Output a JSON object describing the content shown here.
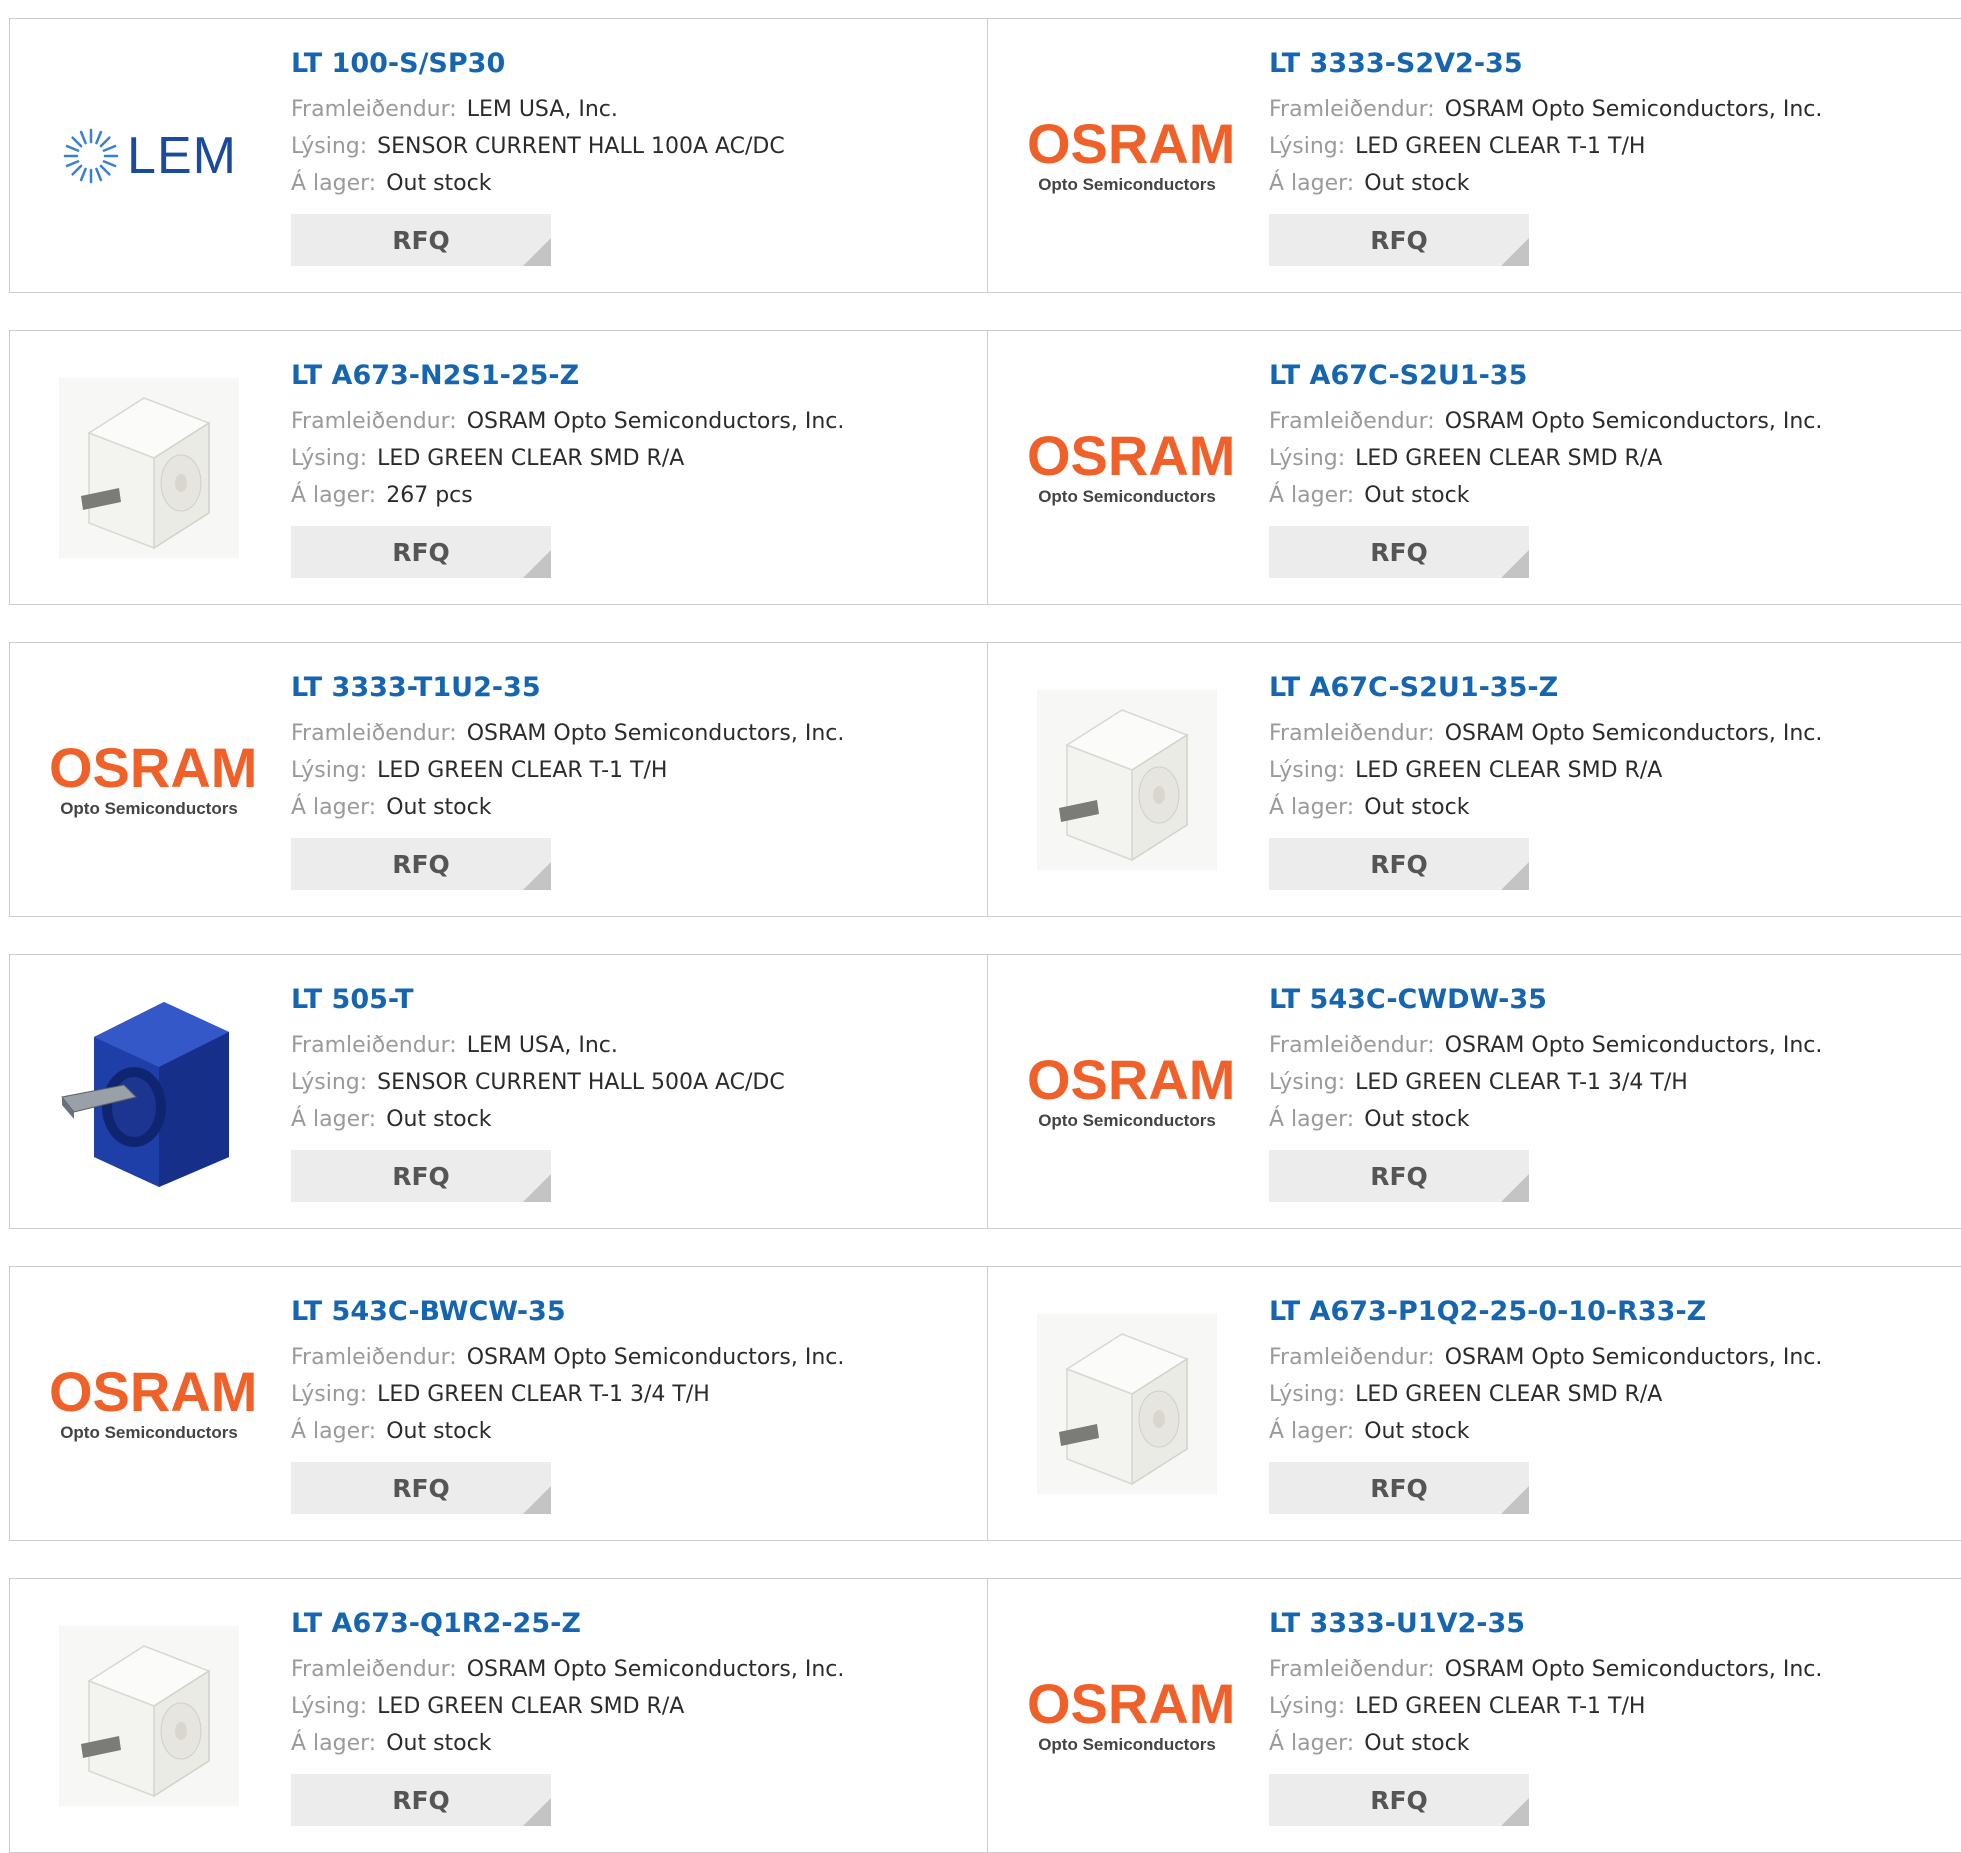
{
  "labels": {
    "manufacturer": "Framleiðendur:",
    "description": "Lýsing:",
    "stock": "Á lager:",
    "rfq": "RFQ"
  },
  "products": [
    {
      "part": "LT 100-S/SP30",
      "manufacturer": "LEM USA, Inc.",
      "description": "SENSOR CURRENT HALL 100A AC/DC",
      "stock": "Out stock",
      "image": "lem-logo",
      "logo_text": "LEM"
    },
    {
      "part": "LT 3333-S2V2-35",
      "manufacturer": "OSRAM Opto Semiconductors, Inc.",
      "description": "LED GREEN CLEAR T-1 T/H",
      "stock": "Out stock",
      "image": "osram-logo",
      "logo_text": "OSRAM",
      "logo_sub": "Opto Semiconductors"
    },
    {
      "part": "LT A673-N2S1-25-Z",
      "manufacturer": "OSRAM Opto Semiconductors, Inc.",
      "description": "LED GREEN CLEAR SMD R/A",
      "stock": "267 pcs",
      "image": "smd-led-photo"
    },
    {
      "part": "LT A67C-S2U1-35",
      "manufacturer": "OSRAM Opto Semiconductors, Inc.",
      "description": "LED GREEN CLEAR SMD R/A",
      "stock": "Out stock",
      "image": "osram-logo",
      "logo_text": "OSRAM",
      "logo_sub": "Opto Semiconductors"
    },
    {
      "part": "LT 3333-T1U2-35",
      "manufacturer": "OSRAM Opto Semiconductors, Inc.",
      "description": "LED GREEN CLEAR T-1 T/H",
      "stock": "Out stock",
      "image": "osram-logo",
      "logo_text": "OSRAM",
      "logo_sub": "Opto Semiconductors"
    },
    {
      "part": "LT A67C-S2U1-35-Z",
      "manufacturer": "OSRAM Opto Semiconductors, Inc.",
      "description": "LED GREEN CLEAR SMD R/A",
      "stock": "Out stock",
      "image": "smd-led-photo"
    },
    {
      "part": "LT 505-T",
      "manufacturer": "LEM USA, Inc.",
      "description": "SENSOR CURRENT HALL 500A AC/DC",
      "stock": "Out stock",
      "image": "current-sensor-photo"
    },
    {
      "part": "LT 543C-CWDW-35",
      "manufacturer": "OSRAM Opto Semiconductors, Inc.",
      "description": "LED GREEN CLEAR T-1 3/4 T/H",
      "stock": "Out stock",
      "image": "osram-logo",
      "logo_text": "OSRAM",
      "logo_sub": "Opto Semiconductors"
    },
    {
      "part": "LT 543C-BWCW-35",
      "manufacturer": "OSRAM Opto Semiconductors, Inc.",
      "description": "LED GREEN CLEAR T-1 3/4 T/H",
      "stock": "Out stock",
      "image": "osram-logo",
      "logo_text": "OSRAM",
      "logo_sub": "Opto Semiconductors"
    },
    {
      "part": "LT A673-P1Q2-25-0-10-R33-Z",
      "manufacturer": "OSRAM Opto Semiconductors, Inc.",
      "description": "LED GREEN CLEAR SMD R/A",
      "stock": "Out stock",
      "image": "smd-led-photo"
    },
    {
      "part": "LT A673-Q1R2-25-Z",
      "manufacturer": "OSRAM Opto Semiconductors, Inc.",
      "description": "LED GREEN CLEAR SMD R/A",
      "stock": "Out stock",
      "image": "smd-led-photo"
    },
    {
      "part": "LT 3333-U1V2-35",
      "manufacturer": "OSRAM Opto Semiconductors, Inc.",
      "description": "LED GREEN CLEAR T-1 T/H",
      "stock": "Out stock",
      "image": "osram-logo",
      "logo_text": "OSRAM",
      "logo_sub": "Opto Semiconductors"
    }
  ],
  "colors": {
    "title": "#1565b0",
    "osram_orange": "#f0612a",
    "lem_blue": "#1a4aa0",
    "border": "#cdcdcd",
    "rfq_bg": "#ececec"
  }
}
